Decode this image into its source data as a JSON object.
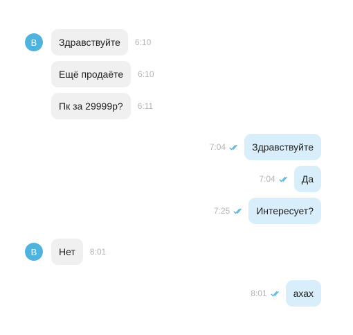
{
  "contact": {
    "avatar_letter": "B"
  },
  "messages": [
    {
      "dir": "in",
      "text": "Здравствуйте",
      "time": "6:10"
    },
    {
      "dir": "in",
      "text": "Ещё продаёте",
      "time": "6:10"
    },
    {
      "dir": "in",
      "text": "Пк за 29999р?",
      "time": "6:11"
    },
    {
      "dir": "out",
      "text": "Здравствуйте",
      "time": "7:04",
      "status": "read-double-check-icon"
    },
    {
      "dir": "out",
      "text": "Да",
      "time": "7:04",
      "status": "read-double-check-icon"
    },
    {
      "dir": "out",
      "text": "Интересует?",
      "time": "7:25",
      "status": "read-double-check-icon"
    },
    {
      "dir": "in",
      "text": "Нет",
      "time": "8:01"
    },
    {
      "dir": "out",
      "text": "ахах",
      "time": "8:01",
      "status": "read-double-check-icon"
    }
  ],
  "colors": {
    "incoming_bubble": "#f0f0f0",
    "outgoing_bubble": "#d9eefb",
    "avatar": "#4fb3de",
    "read_check": "#4fb3de",
    "time_text": "#b4b4b4"
  }
}
